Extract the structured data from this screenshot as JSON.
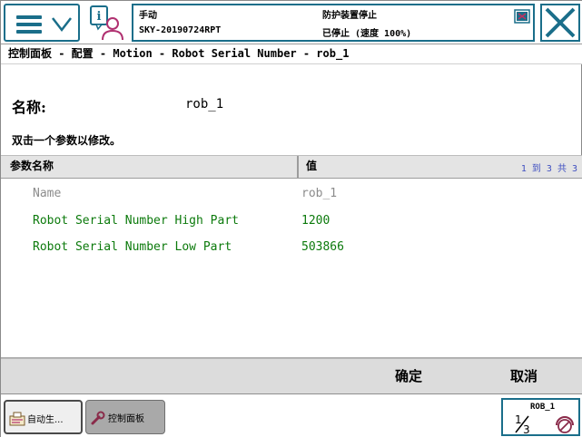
{
  "header": {
    "mode": "手动",
    "system_name": "SKY-20190724RPT",
    "guard_status": "防护装置停止",
    "run_status": "已停止 (速度 100%)",
    "accent_color": "#1a6e8a"
  },
  "breadcrumb": "控制面板 - 配置 - Motion - Robot Serial Number - rob_1",
  "instance": {
    "name_label": "名称:",
    "name_value": "rob_1"
  },
  "hint": "双击一个参数以修改。",
  "table": {
    "columns": [
      "参数名称",
      "值"
    ],
    "pager": "1 到 3 共 3",
    "rows": [
      {
        "name": "Name",
        "value": "rob_1",
        "editable": false
      },
      {
        "name": "Robot Serial Number High Part",
        "value": "1200",
        "editable": true
      },
      {
        "name": "Robot Serial Number Low Part",
        "value": "503866",
        "editable": true
      }
    ]
  },
  "actions": {
    "ok_label": "确定",
    "cancel_label": "取消"
  },
  "taskbar": {
    "auto_label": "自动生...",
    "panel_label": "控制面板",
    "rob_label": "ROB_1"
  },
  "icons": {
    "menu": "menu-icon",
    "info": "info-person-icon",
    "quickset": "quickset-icon",
    "close": "close-icon",
    "auto": "auto-produce-icon",
    "panel": "wrench-icon",
    "fraction": "one-third-icon",
    "speed": "speed-stop-icon"
  }
}
